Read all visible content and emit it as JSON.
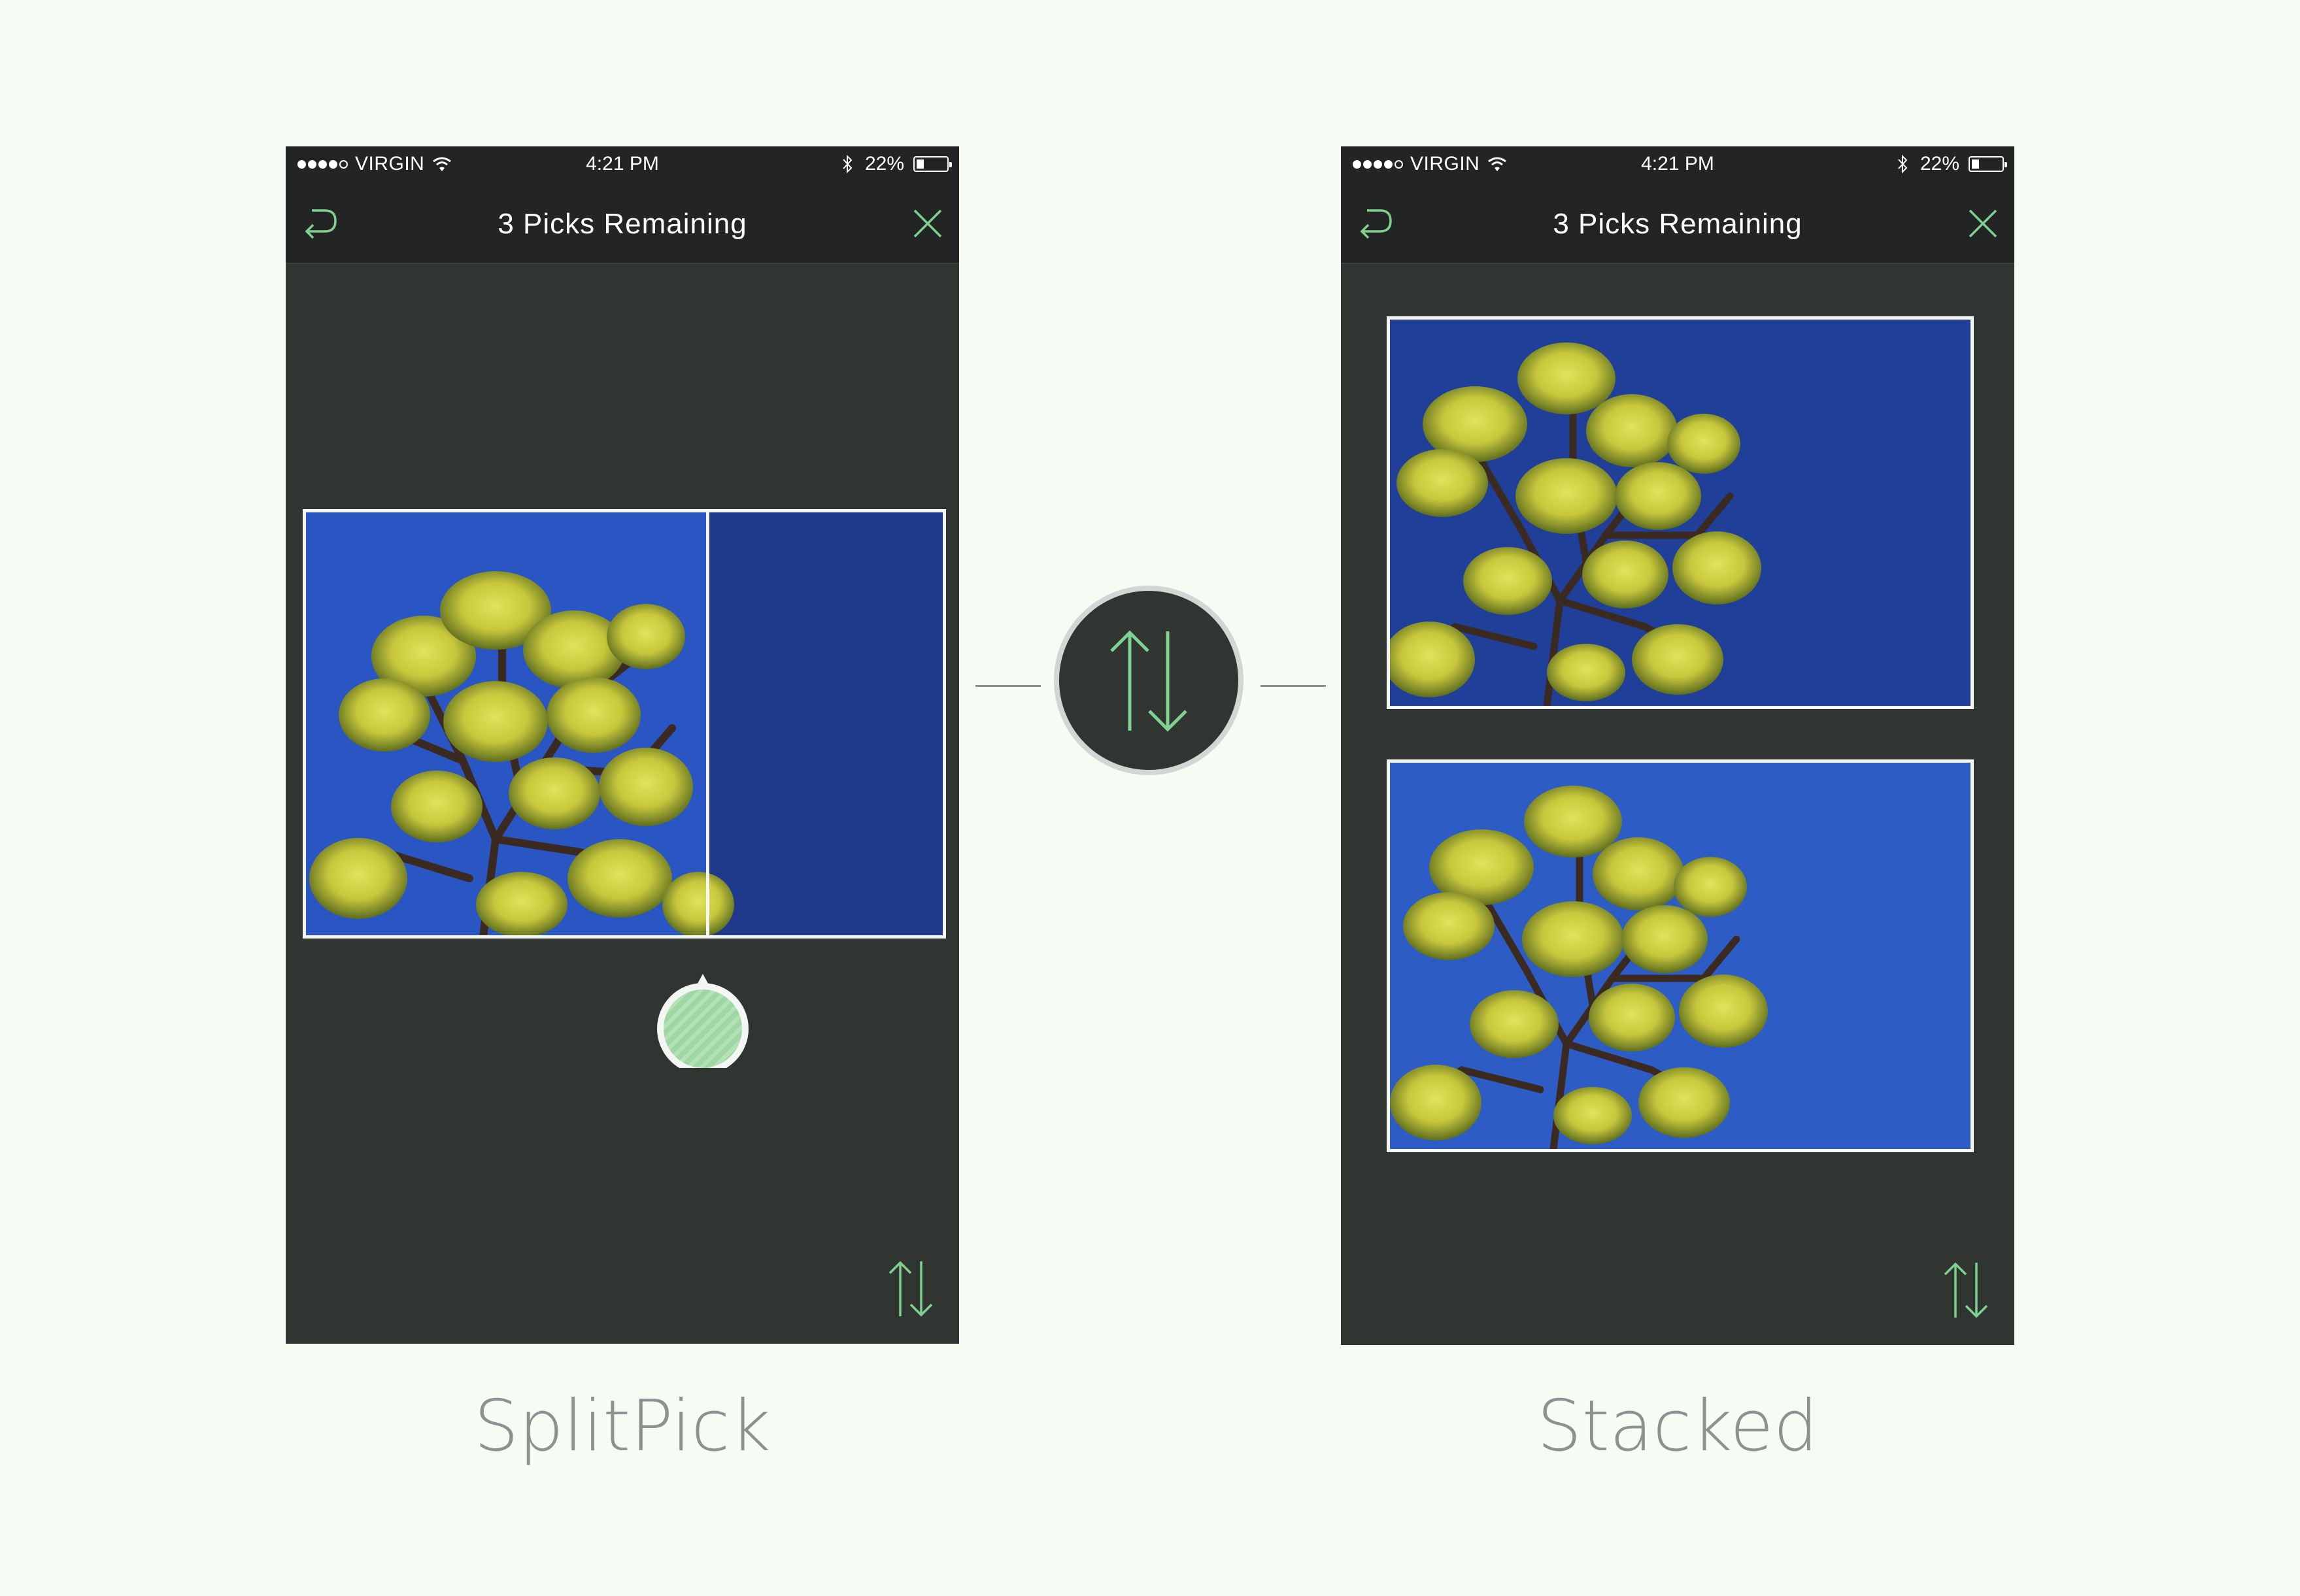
{
  "colors": {
    "accent": "#7fd18f",
    "phone_background": "#313532",
    "nav_background": "#222523",
    "page_background": "#f6fcf4",
    "caption": "#8e918e"
  },
  "left_phone": {
    "status_bar": {
      "carrier": "VIRGIN",
      "time": "4:21 PM",
      "battery": "22%"
    },
    "nav": {
      "title": "3 Picks Remaining",
      "left_icon": "undo-icon",
      "right_icon": "close-icon"
    },
    "bottom_icon": "swap-vertical-icon",
    "caption": "SplitPick"
  },
  "right_phone": {
    "status_bar": {
      "carrier": "VIRGIN",
      "time": "4:21 PM",
      "battery": "22%"
    },
    "nav": {
      "title": "3 Picks Remaining",
      "left_icon": "undo-icon",
      "right_icon": "close-icon"
    },
    "bottom_icon": "swap-vertical-icon",
    "caption": "Stacked"
  },
  "center": {
    "icon": "swap-vertical-icon"
  }
}
